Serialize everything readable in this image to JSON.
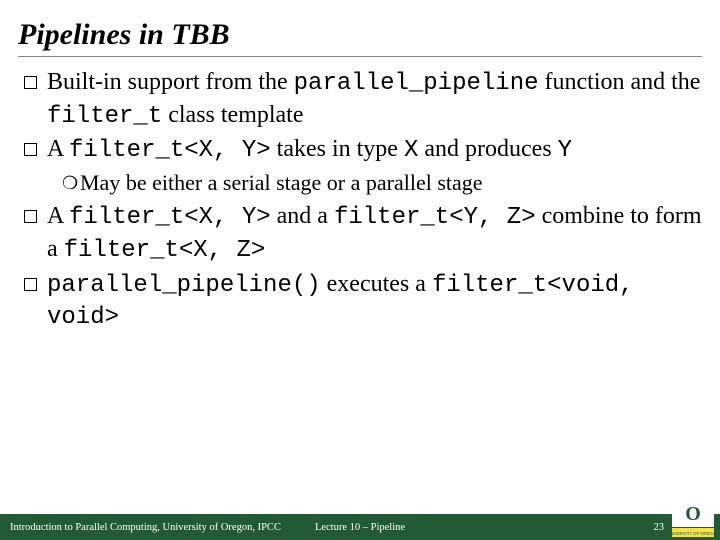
{
  "title": "Pipelines in TBB",
  "bullets": {
    "b1": {
      "t1": "Built-in support from the ",
      "c1": "parallel_pipeline",
      "t2": " function and the ",
      "c2": "filter_t",
      "t3": " class template"
    },
    "b2": {
      "t1": "A ",
      "c1": "filter_t<X, Y>",
      "t2": " takes in type ",
      "c2": "X",
      "t3": " and produces ",
      "c3": "Y"
    },
    "sub1": "May be either a serial stage or a parallel stage",
    "b3": {
      "t1": "A ",
      "c1": "filter_t<X, Y>",
      "t2": " and a ",
      "c2": "filter_t<Y, Z>",
      "t3": " combine to form a ",
      "c3": "filter_t<X, Z>"
    },
    "b4": {
      "c1": "parallel_pipeline()",
      "t1": " executes a ",
      "c2": "filter_t<void, void>"
    }
  },
  "footer": {
    "left": "Introduction to Parallel Computing, University of Oregon, IPCC",
    "center": "Lecture 10 – Pipeline",
    "page": "23"
  },
  "chart_data": {
    "type": "table",
    "title": "Pipelines in TBB",
    "rows": [
      "Built-in support from the parallel_pipeline function and the filter_t class template",
      "A filter_t<X, Y> takes in type X and produces Y",
      "May be either a serial stage or a parallel stage",
      "A filter_t<X, Y> and a filter_t<Y, Z> combine to form a filter_t<X, Z>",
      "parallel_pipeline() executes a filter_t<void, void>"
    ],
    "footer_left": "Introduction to Parallel Computing, University of Oregon, IPCC",
    "footer_center": "Lecture 10 – Pipeline",
    "page_number": 23
  }
}
